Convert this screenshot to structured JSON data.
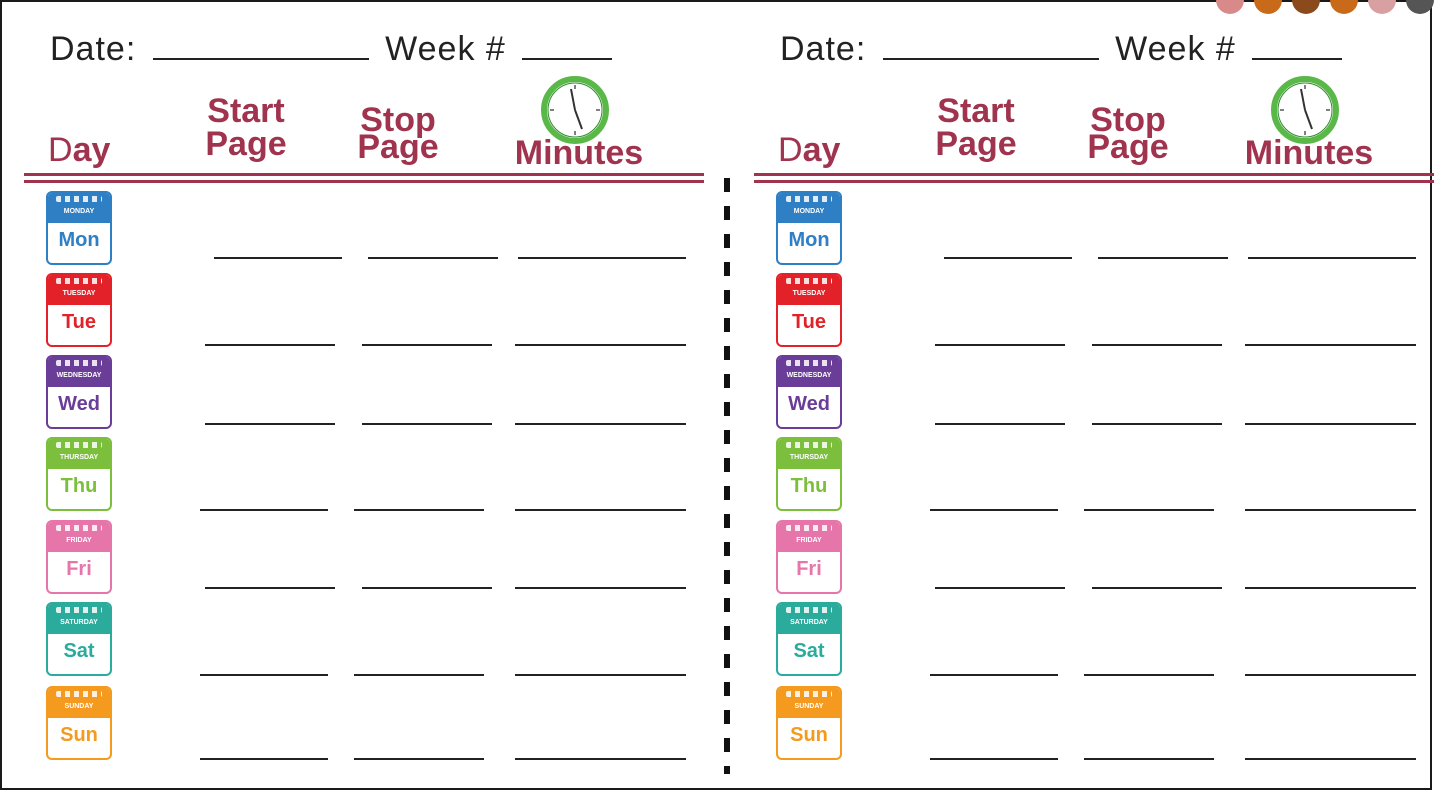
{
  "worksheet": {
    "date_label": "Date:",
    "week_label": "Week #",
    "headers": {
      "day_first": "D",
      "day_rest": "ay",
      "start_1": "Start",
      "start_2": "Page",
      "stop_1": "Stop",
      "stop_2": "Page",
      "minutes": "Minutes"
    },
    "days": [
      {
        "label": "MONDAY",
        "short": "Mon",
        "color": "#2f7fc5"
      },
      {
        "label": "TUESDAY",
        "short": "Tue",
        "color": "#e32128"
      },
      {
        "label": "WEDNESDAY",
        "short": "Wed",
        "color": "#6a3d98"
      },
      {
        "label": "THURSDAY",
        "short": "Thu",
        "color": "#7cbf3d"
      },
      {
        "label": "FRIDAY",
        "short": "Fri",
        "color": "#e676aa"
      },
      {
        "label": "SATURDAY",
        "short": "Sat",
        "color": "#2aab9c"
      },
      {
        "label": "SUNDAY",
        "short": "Sun",
        "color": "#f39a1f"
      }
    ]
  },
  "colors": {
    "header_text": "#a0334e",
    "clock_green": "#5ab848",
    "divider": "#111111"
  },
  "icons": [
    "clock-icon",
    "calendar-icon"
  ]
}
